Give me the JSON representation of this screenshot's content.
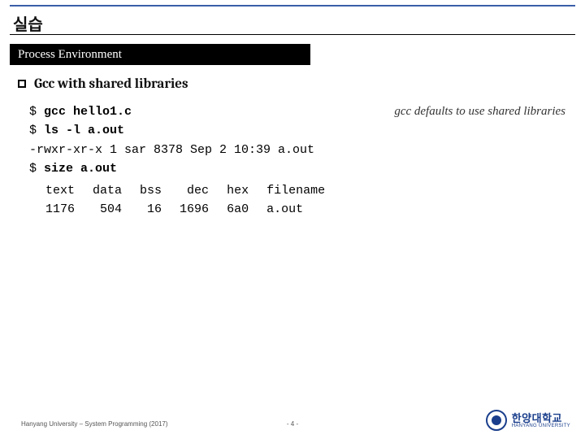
{
  "header": {
    "title": "실습"
  },
  "section": {
    "label": "Process Environment"
  },
  "subhead": {
    "text": "Gcc with shared libraries"
  },
  "terminal": {
    "note": "gcc defaults to use shared libraries",
    "line1_prompt": "$ ",
    "line1_cmd": "gcc hello1.c",
    "line2_prompt": "$ ",
    "line2_cmd": "ls -l a.out",
    "line3": "-rwxr-xr-x  1 sar         8378 Sep 2 10:39 a.out",
    "line4_prompt": "$ ",
    "line4_cmd": "size a.out",
    "size_headers": [
      "text",
      "data",
      "bss",
      "dec",
      "hex",
      "filename"
    ],
    "size_values": [
      "1176",
      "504",
      "16",
      "1696",
      "6a0",
      "a.out"
    ]
  },
  "footer": {
    "left": "Hanyang University – System Programming (2017)",
    "page": "- 4 -",
    "logo_ko": "한양대학교",
    "logo_en": "HANYANG UNIVERSITY"
  }
}
